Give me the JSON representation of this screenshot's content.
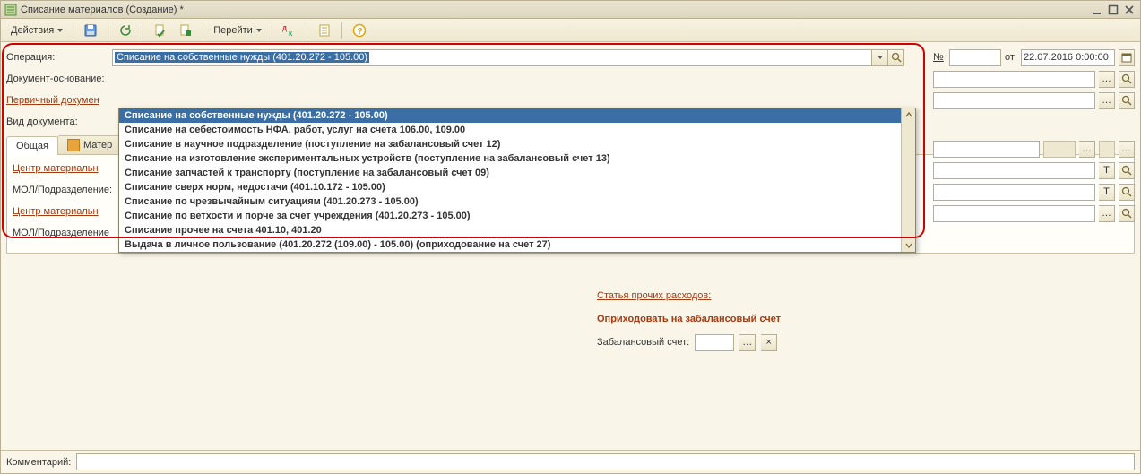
{
  "window": {
    "title": "Списание материалов (Создание) *"
  },
  "toolbar": {
    "actions_label": "Действия",
    "goto_label": "Перейти"
  },
  "labels": {
    "operation": "Операция:",
    "doc_basis": "Документ-основание:",
    "primary_doc": "Первичный докумен",
    "doc_type": "Вид документа:",
    "number": "№",
    "from": "от",
    "date_value": "22.07.2016 0:00:00",
    "center1": "Центр материальн",
    "mol1": "МОЛ/Подразделение:",
    "center2": "Центр материальн",
    "mol2": "МОЛ/Подразделение",
    "other_exp": "Статья прочих расходов:",
    "offbalance_post": "Оприходовать на забалансовый счет",
    "offbalance_acc": "Забалансовый счет:",
    "comment": "Комментарий:"
  },
  "tabs": {
    "general": "Общая",
    "materials": "Матер"
  },
  "operation_selected": "Списание на собственные нужды (401.20.272 - 105.00)",
  "operation_options": [
    "Списание на собственные нужды (401.20.272 - 105.00)",
    "Списание на себестоимость НФА, работ, услуг на счета 106.00, 109.00",
    "Списание в научное подразделение (поступление на забалансовый счет 12)",
    "Списание на изготовление экспериментальных устройств (поступление на забалансовый счет 13)",
    "Списание запчастей к транспорту (поступление на забалансовый счет 09)",
    "Списание сверх норм, недостачи (401.10.172 - 105.00)",
    "Списание по чрезвычайным ситуациям (401.20.273 - 105.00)",
    "Списание по ветхости и порче за счет учреждения (401.20.273 - 105.00)",
    "Списание прочее на счета 401.10, 401.20",
    "Выдача в личное пользование (401.20.272 (109.00) - 105.00) (оприходование на счет 27)"
  ]
}
